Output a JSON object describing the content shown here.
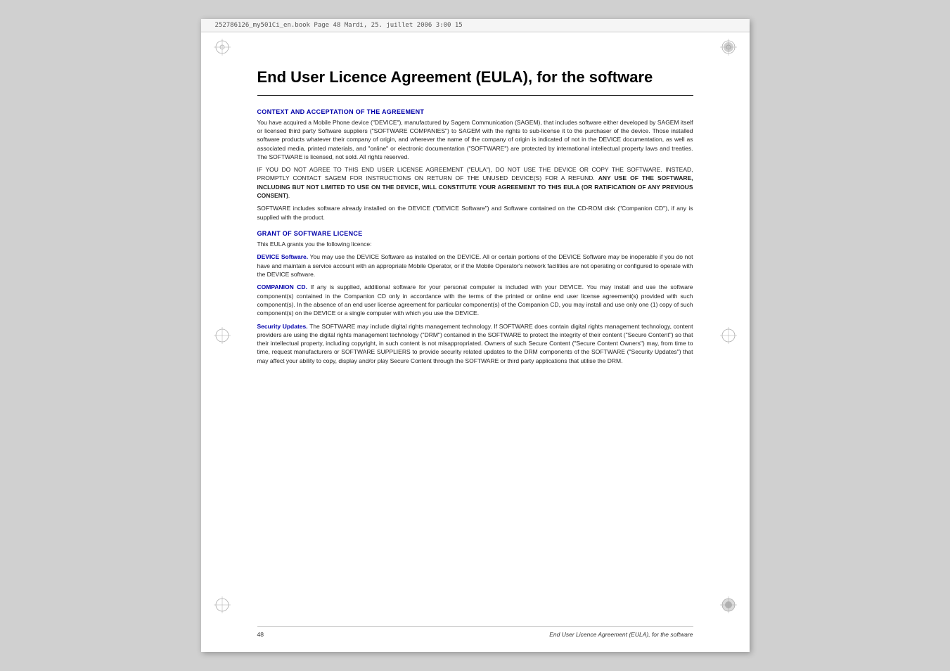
{
  "header": {
    "file_info": "252786126_my501Ci_en.book  Page 48  Mardi, 25. juillet 2006  3:00 15"
  },
  "page_title": "End User Licence Agreement (EULA), for the software",
  "sections": [
    {
      "id": "context",
      "heading": "CONTEXT AND ACCEPTATION OF THE AGREEMENT",
      "paragraphs": [
        "You have acquired a Mobile Phone device (\"DEVICE\"), manufactured by Sagem Communication (SAGEM), that includes software either developed by SAGEM itself or licensed third party Software suppliers (\"SOFTWARE COMPANIES\") to SAGEM with the rights to sub-license it to the purchaser of the device. Those installed software products whatever their company of origin, and wherever the name of the company of origin is indicated of not in the DEVICE documentation, as well as associated media, printed materials, and \"online\" or electronic documentation (\"SOFTWARE\") are protected by international intellectual property laws and treaties. The SOFTWARE is licensed, not sold.  All rights reserved.",
        "IF YOU DO NOT AGREE TO THIS END USER LICENSE AGREEMENT (\"EULA\"), DO NOT USE THE DEVICE OR COPY THE SOFTWARE. INSTEAD, PROMPTLY CONTACT SAGEM FOR INSTRUCTIONS ON RETURN OF THE UNUSED DEVICE(S) FOR A REFUND. ANY USE OF THE SOFTWARE, INCLUDING BUT NOT LIMITED TO USE ON THE DEVICE, WILL CONSTITUTE YOUR AGREEMENT TO THIS EULA (OR RATIFICATION OF ANY PREVIOUS CONSENT).",
        "SOFTWARE includes software already installed on the DEVICE (\"DEVICE Software\") and Software contained on the CD-ROM disk (\"Companion CD\"), if any is supplied with the product."
      ]
    },
    {
      "id": "grant",
      "heading": "GRANT OF SOFTWARE LICENCE",
      "intro": "This EULA grants you the following licence:",
      "subsections": [
        {
          "label": "DEVICE Software.",
          "text": " You may use the DEVICE Software as installed on the DEVICE.  All or certain portions of the DEVICE Software may be inoperable if you do not have and maintain a service account with an appropriate Mobile Operator, or if the Mobile Operator's network facilities are not operating or configured to operate with the DEVICE software."
        },
        {
          "label": "COMPANION CD.",
          "text": " If any is supplied, additional software for your personal computer is included with your DEVICE. You may install and use the software component(s) contained in the Companion CD only in accordance with the terms of the printed or online end user license agreement(s) provided with such component(s). In the absence of an end user license agreement for particular component(s) of the Companion CD, you may install and use only one (1) copy of such component(s) on the DEVICE or a single computer with which you use the DEVICE."
        },
        {
          "label": "Security Updates.",
          "text": " The SOFTWARE may include digital rights management technology.  If SOFTWARE does contain digital rights management technology, content providers are using the digital rights management technology (\"DRM\") contained in the SOFTWARE to protect the integrity of their content (\"Secure Content\") so that their intellectual property, including copyright, in such content is not misappropriated.  Owners of such Secure Content (\"Secure Content Owners\") may, from time to time, request manufacturers or SOFTWARE SUPPLIERS to provide security related updates to the DRM components of the SOFTWARE (\"Security Updates\") that may affect your ability to copy, display and/or play Secure Content through the SOFTWARE or third party applications that utilise the DRM."
        }
      ]
    }
  ],
  "footer": {
    "page_number": "48",
    "title": "End User Licence Agreement (EULA), for the software"
  }
}
